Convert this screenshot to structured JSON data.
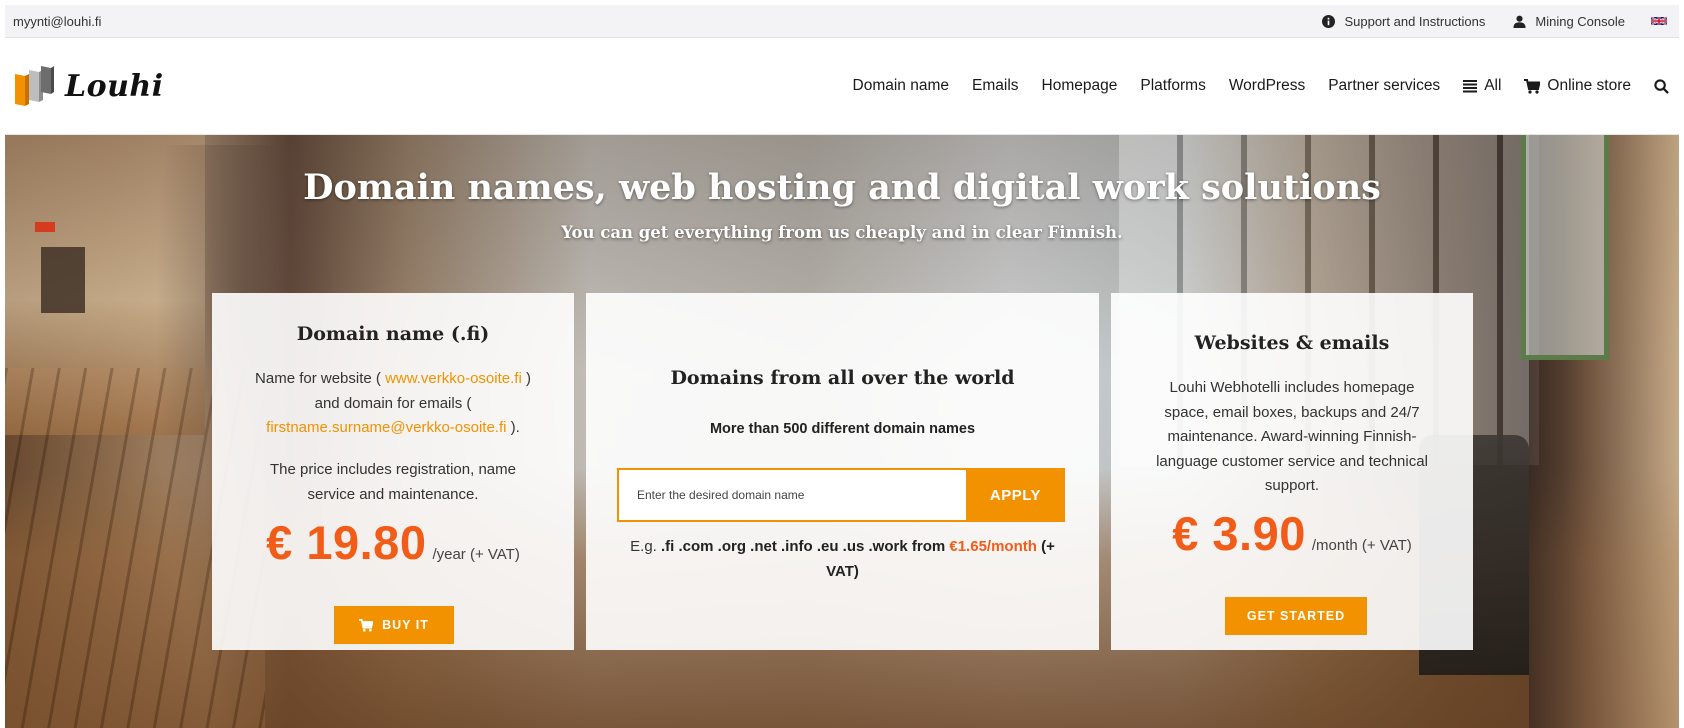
{
  "topbar": {
    "email": "myynti@louhi.fi",
    "support_label": "Support and Instructions",
    "support_icon": "info-circle-icon",
    "console_label": "Mining Console",
    "console_icon": "user-icon",
    "language_icon": "uk-flag-icon"
  },
  "header": {
    "logo_text": "Louhi",
    "nav": [
      {
        "label": "Domain name"
      },
      {
        "label": "Emails"
      },
      {
        "label": "Homepage"
      },
      {
        "label": "Platforms"
      },
      {
        "label": "WordPress"
      },
      {
        "label": "Partner services"
      },
      {
        "label": "All",
        "icon": "list-icon"
      },
      {
        "label": "Online store",
        "icon": "cart-icon"
      }
    ],
    "search_icon": "search-icon"
  },
  "hero": {
    "title": "Domain names, web hosting and digital work solutions",
    "subtitle": "You can get everything from us cheaply and in clear Finnish."
  },
  "cards": {
    "domain_fi": {
      "title": "Domain name (.fi)",
      "desc_1": "Name for website (",
      "link_1": "www.verkko-osoite.fi",
      "desc_2": ") and domain for emails (",
      "link_2": "firstname.surname@verkko-osoite.fi",
      "desc_3": ").",
      "price_note": "The price includes registration, name service and maintenance.",
      "price": "€ 19.80",
      "price_unit": "/year (+ VAT)",
      "button_label": "BUY IT"
    },
    "domains_world": {
      "title": "Domains from all over the world",
      "subtitle": "More than 500 different domain names",
      "search_placeholder": "Enter the desired domain name",
      "search_value": "",
      "apply_label": "APPLY",
      "eg_prefix": "E.g.",
      "eg_tlds": ".fi .com .org .net .info .eu .us .work",
      "eg_from": "from",
      "eg_price": "€1.65/month",
      "eg_vat": "(+ VAT)"
    },
    "websites": {
      "title": "Websites & emails",
      "desc": "Louhi Webhotelli includes homepage space, email boxes, backups and 24/7 maintenance. Award-winning Finnish-language customer service and technical support.",
      "price": "€ 3.90",
      "price_unit": "/month (+ VAT)",
      "button_label": "GET STARTED"
    }
  },
  "colors": {
    "accent_orange": "#f39200",
    "price_orange": "#f25c19"
  }
}
